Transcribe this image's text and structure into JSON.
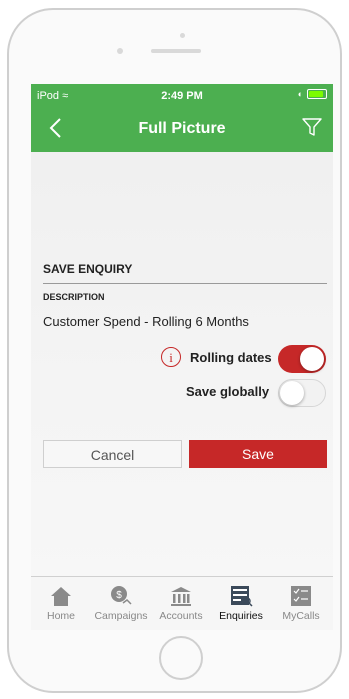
{
  "status": {
    "carrier": "iPod",
    "time": "2:49 PM"
  },
  "header": {
    "title": "Full Picture",
    "back_icon": "chevron-left-icon",
    "filter_icon": "filter-icon"
  },
  "form": {
    "section_title": "SAVE ENQUIRY",
    "description_label": "DESCRIPTION",
    "description_value": "Customer Spend - Rolling 6 Months",
    "rolling_dates_label": "Rolling dates",
    "rolling_dates_on": true,
    "save_globally_label": "Save globally",
    "save_globally_on": false,
    "cancel_label": "Cancel",
    "save_label": "Save"
  },
  "tabs": [
    {
      "label": "Home",
      "icon": "home-icon"
    },
    {
      "label": "Campaigns",
      "icon": "campaigns-icon"
    },
    {
      "label": "Accounts",
      "icon": "bank-icon"
    },
    {
      "label": "Enquiries",
      "icon": "enquiries-icon",
      "active": true
    },
    {
      "label": "MyCalls",
      "icon": "checklist-icon"
    }
  ],
  "colors": {
    "header": "#4caf50",
    "accent_red": "#c62828"
  }
}
